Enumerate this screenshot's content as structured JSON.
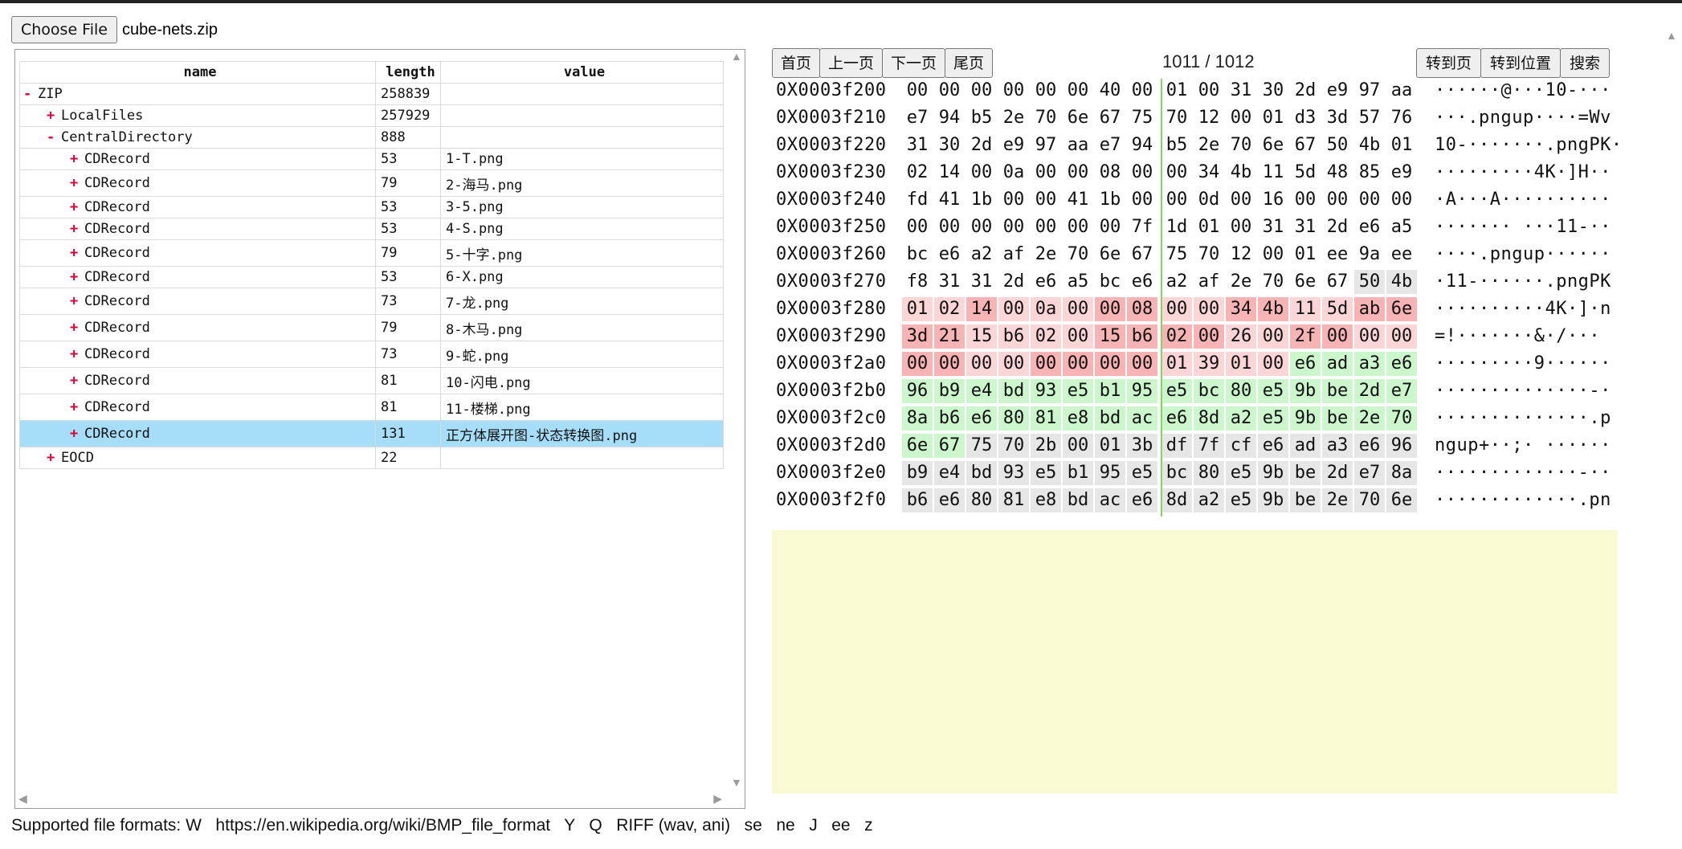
{
  "file_input": {
    "button_label": "Choose File",
    "file_name": "cube-nets.zip"
  },
  "tree": {
    "headers": [
      "name",
      "length",
      "value"
    ],
    "rows": [
      {
        "toggle": "-",
        "indent": 0,
        "name": "ZIP",
        "length": "258839",
        "value": "",
        "tall": false,
        "selected": false
      },
      {
        "toggle": "+",
        "indent": 1,
        "name": "LocalFiles",
        "length": "257929",
        "value": "",
        "tall": false,
        "selected": false
      },
      {
        "toggle": "-",
        "indent": 1,
        "name": "CentralDirectory",
        "length": "888",
        "value": "",
        "tall": false,
        "selected": false
      },
      {
        "toggle": "+",
        "indent": 2,
        "name": "CDRecord",
        "length": "53",
        "value": "1-T.png",
        "tall": false,
        "selected": false
      },
      {
        "toggle": "+",
        "indent": 2,
        "name": "CDRecord",
        "length": "79",
        "value": "2-海马.png",
        "tall": true,
        "selected": false
      },
      {
        "toggle": "+",
        "indent": 2,
        "name": "CDRecord",
        "length": "53",
        "value": "3-5.png",
        "tall": false,
        "selected": false
      },
      {
        "toggle": "+",
        "indent": 2,
        "name": "CDRecord",
        "length": "53",
        "value": "4-S.png",
        "tall": false,
        "selected": false
      },
      {
        "toggle": "+",
        "indent": 2,
        "name": "CDRecord",
        "length": "79",
        "value": "5-十字.png",
        "tall": true,
        "selected": false
      },
      {
        "toggle": "+",
        "indent": 2,
        "name": "CDRecord",
        "length": "53",
        "value": "6-X.png",
        "tall": false,
        "selected": false
      },
      {
        "toggle": "+",
        "indent": 2,
        "name": "CDRecord",
        "length": "73",
        "value": "7-龙.png",
        "tall": true,
        "selected": false
      },
      {
        "toggle": "+",
        "indent": 2,
        "name": "CDRecord",
        "length": "79",
        "value": "8-木马.png",
        "tall": true,
        "selected": false
      },
      {
        "toggle": "+",
        "indent": 2,
        "name": "CDRecord",
        "length": "73",
        "value": "9-蛇.png",
        "tall": true,
        "selected": false
      },
      {
        "toggle": "+",
        "indent": 2,
        "name": "CDRecord",
        "length": "81",
        "value": "10-闪电.png",
        "tall": true,
        "selected": false
      },
      {
        "toggle": "+",
        "indent": 2,
        "name": "CDRecord",
        "length": "81",
        "value": "11-楼梯.png",
        "tall": true,
        "selected": false
      },
      {
        "toggle": "+",
        "indent": 2,
        "name": "CDRecord",
        "length": "131",
        "value": "正方体展开图-状态转换图.png",
        "tall": true,
        "selected": true
      },
      {
        "toggle": "+",
        "indent": 1,
        "name": "EOCD",
        "length": "22",
        "value": "",
        "tall": false,
        "selected": false
      }
    ]
  },
  "hex_nav": {
    "first": "首页",
    "prev": "上一页",
    "next": "下一页",
    "last": "尾页",
    "page_indicator": "1011 / 1012",
    "goto_page": "转到页",
    "goto_position": "转到位置",
    "search": "搜索"
  },
  "hex": {
    "rows": [
      {
        "addr": "0X0003f200",
        "bytes": [
          "00",
          "00",
          "00",
          "00",
          "00",
          "00",
          "40",
          "00",
          "01",
          "00",
          "31",
          "30",
          "2d",
          "e9",
          "97",
          "aa"
        ],
        "hl": [
          "",
          "",
          "",
          "",
          "",
          "",
          "",
          "",
          "",
          "",
          "",
          "",
          "",
          "",
          "",
          ""
        ],
        "ascii": "······@···10-···"
      },
      {
        "addr": "0X0003f210",
        "bytes": [
          "e7",
          "94",
          "b5",
          "2e",
          "70",
          "6e",
          "67",
          "75",
          "70",
          "12",
          "00",
          "01",
          "d3",
          "3d",
          "57",
          "76"
        ],
        "hl": [
          "",
          "",
          "",
          "",
          "",
          "",
          "",
          "",
          "",
          "",
          "",
          "",
          "",
          "",
          "",
          ""
        ],
        "ascii": "···.pngup····=Wv"
      },
      {
        "addr": "0X0003f220",
        "bytes": [
          "31",
          "30",
          "2d",
          "e9",
          "97",
          "aa",
          "e7",
          "94",
          "b5",
          "2e",
          "70",
          "6e",
          "67",
          "50",
          "4b",
          "01"
        ],
        "hl": [
          "",
          "",
          "",
          "",
          "",
          "",
          "",
          "",
          "",
          "",
          "",
          "",
          "",
          "",
          "",
          ""
        ],
        "ascii": "10-·······.pngPK·"
      },
      {
        "addr": "0X0003f230",
        "bytes": [
          "02",
          "14",
          "00",
          "0a",
          "00",
          "00",
          "08",
          "00",
          "00",
          "34",
          "4b",
          "11",
          "5d",
          "48",
          "85",
          "e9"
        ],
        "hl": [
          "",
          "",
          "",
          "",
          "",
          "",
          "",
          "",
          "",
          "",
          "",
          "",
          "",
          "",
          "",
          ""
        ],
        "ascii": "·········4K·]H··"
      },
      {
        "addr": "0X0003f240",
        "bytes": [
          "fd",
          "41",
          "1b",
          "00",
          "00",
          "41",
          "1b",
          "00",
          "00",
          "0d",
          "00",
          "16",
          "00",
          "00",
          "00",
          "00"
        ],
        "hl": [
          "",
          "",
          "",
          "",
          "",
          "",
          "",
          "",
          "",
          "",
          "",
          "",
          "",
          "",
          "",
          ""
        ],
        "ascii": "·A···A··········"
      },
      {
        "addr": "0X0003f250",
        "bytes": [
          "00",
          "00",
          "00",
          "00",
          "00",
          "00",
          "00",
          "7f",
          "1d",
          "01",
          "00",
          "31",
          "31",
          "2d",
          "e6",
          "a5"
        ],
        "hl": [
          "",
          "",
          "",
          "",
          "",
          "",
          "",
          "",
          "",
          "",
          "",
          "",
          "",
          "",
          "",
          ""
        ],
        "ascii": "······· ···11-··"
      },
      {
        "addr": "0X0003f260",
        "bytes": [
          "bc",
          "e6",
          "a2",
          "af",
          "2e",
          "70",
          "6e",
          "67",
          "75",
          "70",
          "12",
          "00",
          "01",
          "ee",
          "9a",
          "ee"
        ],
        "hl": [
          "",
          "",
          "",
          "",
          "",
          "",
          "",
          "",
          "",
          "",
          "",
          "",
          "",
          "",
          "",
          ""
        ],
        "ascii": "····.pngup······"
      },
      {
        "addr": "0X0003f270",
        "bytes": [
          "f8",
          "31",
          "31",
          "2d",
          "e6",
          "a5",
          "bc",
          "e6",
          "a2",
          "af",
          "2e",
          "70",
          "6e",
          "67",
          "50",
          "4b"
        ],
        "hl": [
          "",
          "",
          "",
          "",
          "",
          "",
          "",
          "",
          "",
          "",
          "",
          "",
          "",
          "",
          "g",
          "g"
        ],
        "ascii": "·11-······.pngPK"
      },
      {
        "addr": "0X0003f280",
        "bytes": [
          "01",
          "02",
          "14",
          "00",
          "0a",
          "00",
          "00",
          "08",
          "00",
          "00",
          "34",
          "4b",
          "11",
          "5d",
          "ab",
          "6e"
        ],
        "hl": [
          "p",
          "p",
          "r",
          "p",
          "p",
          "p",
          "r",
          "r",
          "p",
          "p",
          "r",
          "r",
          "p",
          "p",
          "r",
          "r"
        ],
        "ascii": "··········4K·]·n"
      },
      {
        "addr": "0X0003f290",
        "bytes": [
          "3d",
          "21",
          "15",
          "b6",
          "02",
          "00",
          "15",
          "b6",
          "02",
          "00",
          "26",
          "00",
          "2f",
          "00",
          "00",
          "00"
        ],
        "hl": [
          "r",
          "r",
          "p",
          "p",
          "p",
          "p",
          "r",
          "r",
          "r",
          "r",
          "p",
          "p",
          "r",
          "r",
          "p",
          "p"
        ],
        "ascii": "=!·······&·/···"
      },
      {
        "addr": "0X0003f2a0",
        "bytes": [
          "00",
          "00",
          "00",
          "00",
          "00",
          "00",
          "00",
          "00",
          "01",
          "39",
          "01",
          "00",
          "e6",
          "ad",
          "a3",
          "e6"
        ],
        "hl": [
          "r",
          "r",
          "p",
          "p",
          "r",
          "r",
          "r",
          "r",
          "p",
          "p",
          "p",
          "p",
          "n",
          "n",
          "n",
          "n"
        ],
        "ascii": "·········9······"
      },
      {
        "addr": "0X0003f2b0",
        "bytes": [
          "96",
          "b9",
          "e4",
          "bd",
          "93",
          "e5",
          "b1",
          "95",
          "e5",
          "bc",
          "80",
          "e5",
          "9b",
          "be",
          "2d",
          "e7"
        ],
        "hl": [
          "n",
          "n",
          "n",
          "n",
          "n",
          "n",
          "n",
          "n",
          "n",
          "n",
          "n",
          "n",
          "n",
          "n",
          "n",
          "n"
        ],
        "ascii": "··············-·"
      },
      {
        "addr": "0X0003f2c0",
        "bytes": [
          "8a",
          "b6",
          "e6",
          "80",
          "81",
          "e8",
          "bd",
          "ac",
          "e6",
          "8d",
          "a2",
          "e5",
          "9b",
          "be",
          "2e",
          "70"
        ],
        "hl": [
          "n",
          "n",
          "n",
          "n",
          "n",
          "n",
          "n",
          "n",
          "n",
          "n",
          "n",
          "n",
          "n",
          "n",
          "n",
          "n"
        ],
        "ascii": "··············.p"
      },
      {
        "addr": "0X0003f2d0",
        "bytes": [
          "6e",
          "67",
          "75",
          "70",
          "2b",
          "00",
          "01",
          "3b",
          "df",
          "7f",
          "cf",
          "e6",
          "ad",
          "a3",
          "e6",
          "96"
        ],
        "hl": [
          "n",
          "n",
          "g",
          "g",
          "g",
          "g",
          "g",
          "g",
          "g",
          "g",
          "g",
          "g",
          "g",
          "g",
          "g",
          "g"
        ],
        "ascii": "ngup+··;· ······"
      },
      {
        "addr": "0X0003f2e0",
        "bytes": [
          "b9",
          "e4",
          "bd",
          "93",
          "e5",
          "b1",
          "95",
          "e5",
          "bc",
          "80",
          "e5",
          "9b",
          "be",
          "2d",
          "e7",
          "8a"
        ],
        "hl": [
          "g",
          "g",
          "g",
          "g",
          "g",
          "g",
          "g",
          "g",
          "g",
          "g",
          "g",
          "g",
          "g",
          "g",
          "g",
          "g"
        ],
        "ascii": "·············-··"
      },
      {
        "addr": "0X0003f2f0",
        "bytes": [
          "b6",
          "e6",
          "80",
          "81",
          "e8",
          "bd",
          "ac",
          "e6",
          "8d",
          "a2",
          "e5",
          "9b",
          "be",
          "2e",
          "70",
          "6e"
        ],
        "hl": [
          "g",
          "g",
          "g",
          "g",
          "g",
          "g",
          "g",
          "g",
          "g",
          "g",
          "g",
          "g",
          "g",
          "g",
          "g",
          "g"
        ],
        "ascii": "·············.pn"
      }
    ]
  },
  "footer": {
    "text": "Supported file formats: W   https://en.wikipedia.org/wiki/BMP_file_format   Y   Q   RIFF (wav, ani)   se   ne   J   ee   z"
  },
  "colors": {
    "highlight_red": "#f8b4b4",
    "highlight_pink": "#fcd6d6",
    "highlight_green": "#ccf6cc",
    "highlight_grey": "#e6e6e6",
    "selection": "#a6ddf8",
    "preview_bg": "#f8fad1",
    "divider": "#7fdc5a"
  }
}
